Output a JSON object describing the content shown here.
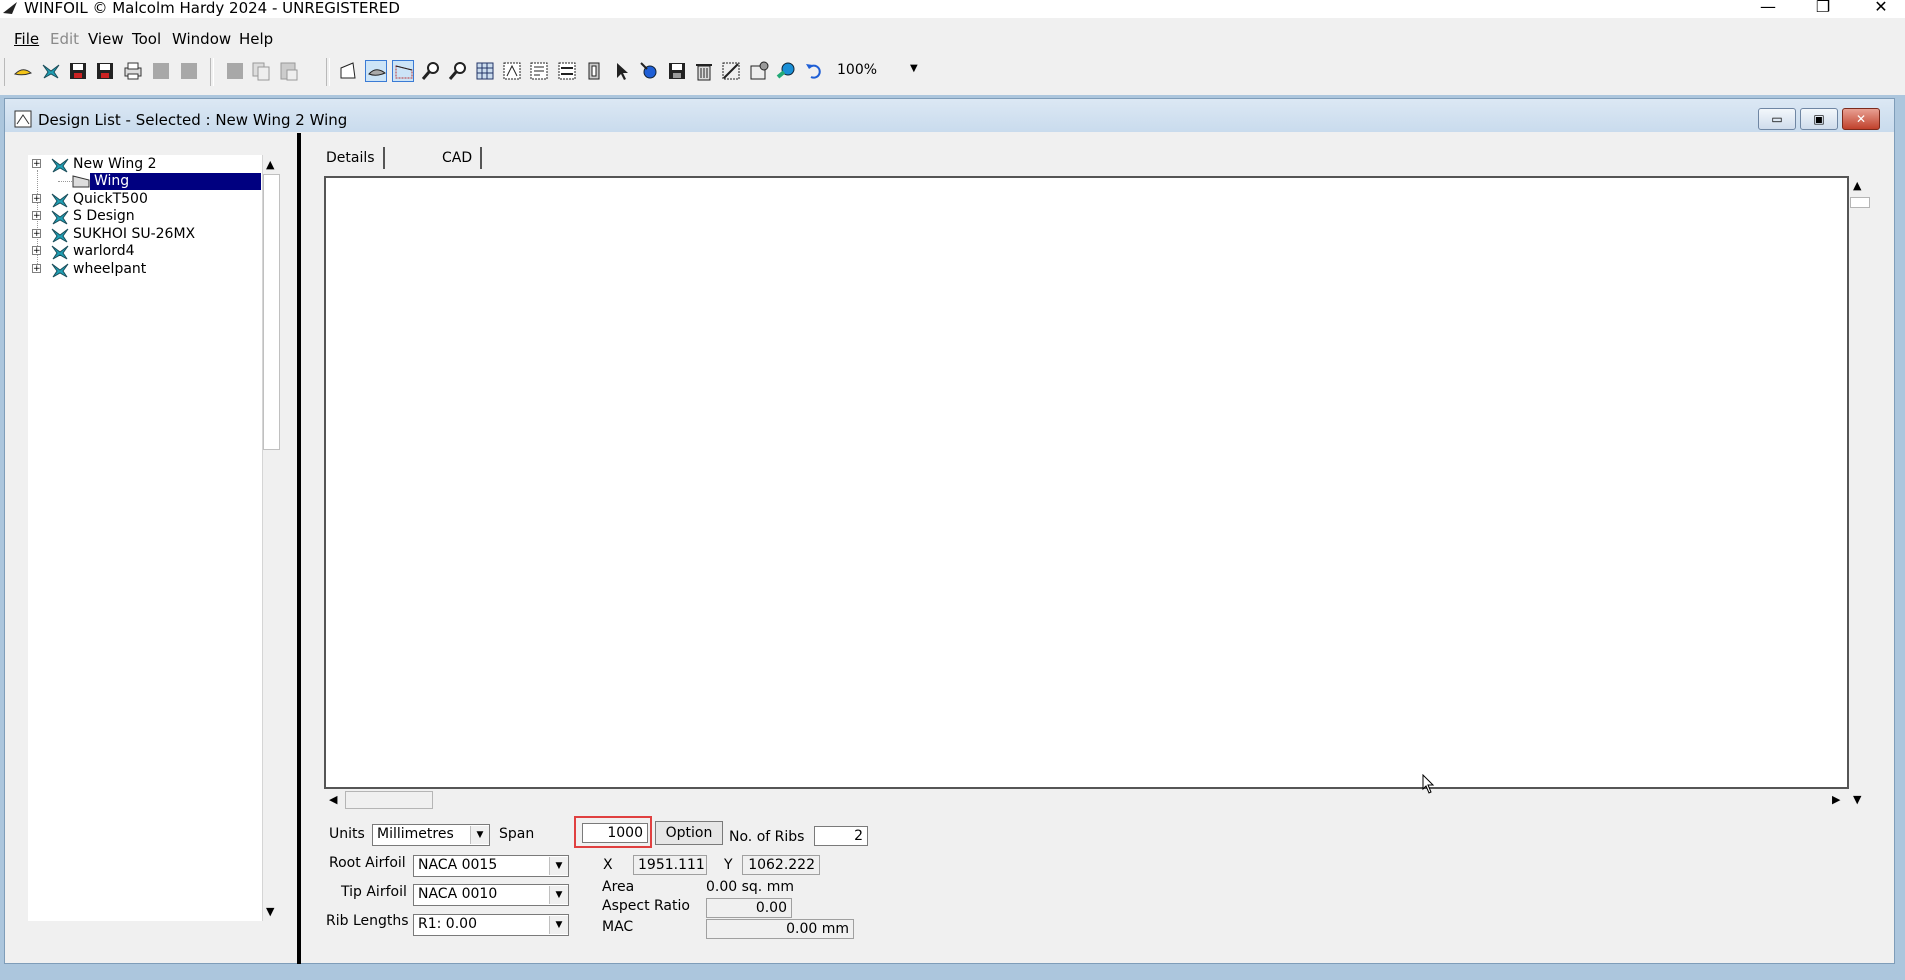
{
  "app": {
    "title": "WINFOIL © Malcolm Hardy 2024 - UNREGISTERED",
    "minimize_glyph": "—",
    "maximize_glyph": "❐",
    "close_glyph": "✕"
  },
  "menu": [
    {
      "label": "File"
    },
    {
      "label": "Edit",
      "disabled": true
    },
    {
      "label": "View"
    },
    {
      "label": "Tool"
    },
    {
      "label": "Window"
    },
    {
      "label": "Help"
    }
  ],
  "toolbar": {
    "zoom_value": "100%",
    "zoom_arrow": "▼"
  },
  "child_window": {
    "title": "Design List - Selected : New Wing 2 Wing",
    "min_glyph": "▭",
    "max_glyph": "▣",
    "close_glyph": "✕"
  },
  "tree": {
    "items": [
      {
        "label": "New Wing 2",
        "expander": "+",
        "icon": "plane-icon"
      },
      {
        "label": "Wing",
        "icon": "wing-icon",
        "selected": true
      },
      {
        "label": "QuickT500",
        "expander": "+",
        "icon": "plane-icon"
      },
      {
        "label": "S Design",
        "expander": "+",
        "icon": "plane-icon"
      },
      {
        "label": "SUKHOI SU-26MX",
        "expander": "+",
        "icon": "plane-icon"
      },
      {
        "label": "warlord4",
        "expander": "+",
        "icon": "plane-icon"
      },
      {
        "label": "wheelpant",
        "expander": "+",
        "icon": "plane-icon"
      }
    ],
    "scroll_up": "▲",
    "scroll_down": "▼"
  },
  "tabs": [
    {
      "label": "Details"
    },
    {
      "label": "CAD"
    }
  ],
  "canvas_scroll": {
    "up": "▲",
    "down": "▼",
    "left": "◀",
    "right": "▶"
  },
  "form": {
    "units_label": "Units",
    "units_value": "Millimetres",
    "span_label": "Span",
    "span_value": "1000",
    "option_button": "Option",
    "ribs_label": "No. of Ribs",
    "ribs_value": "2",
    "root_airfoil_label": "Root Airfoil",
    "root_airfoil_value": "NACA 0015",
    "tip_airfoil_label": "Tip Airfoil",
    "tip_airfoil_value": "NACA 0010",
    "rib_lengths_label": "Rib Lengths",
    "rib_lengths_value": "R1: 0.00",
    "x_label": "X",
    "x_value": "1951.111",
    "y_label": "Y",
    "y_value": "1062.222",
    "area_label": "Area",
    "area_value": "0.00 sq. mm",
    "aspect_ratio_label": "Aspect Ratio",
    "aspect_ratio_value": "0.00",
    "mac_label": "MAC",
    "mac_value": "0.00 mm",
    "dropdown_glyph": "▼"
  }
}
